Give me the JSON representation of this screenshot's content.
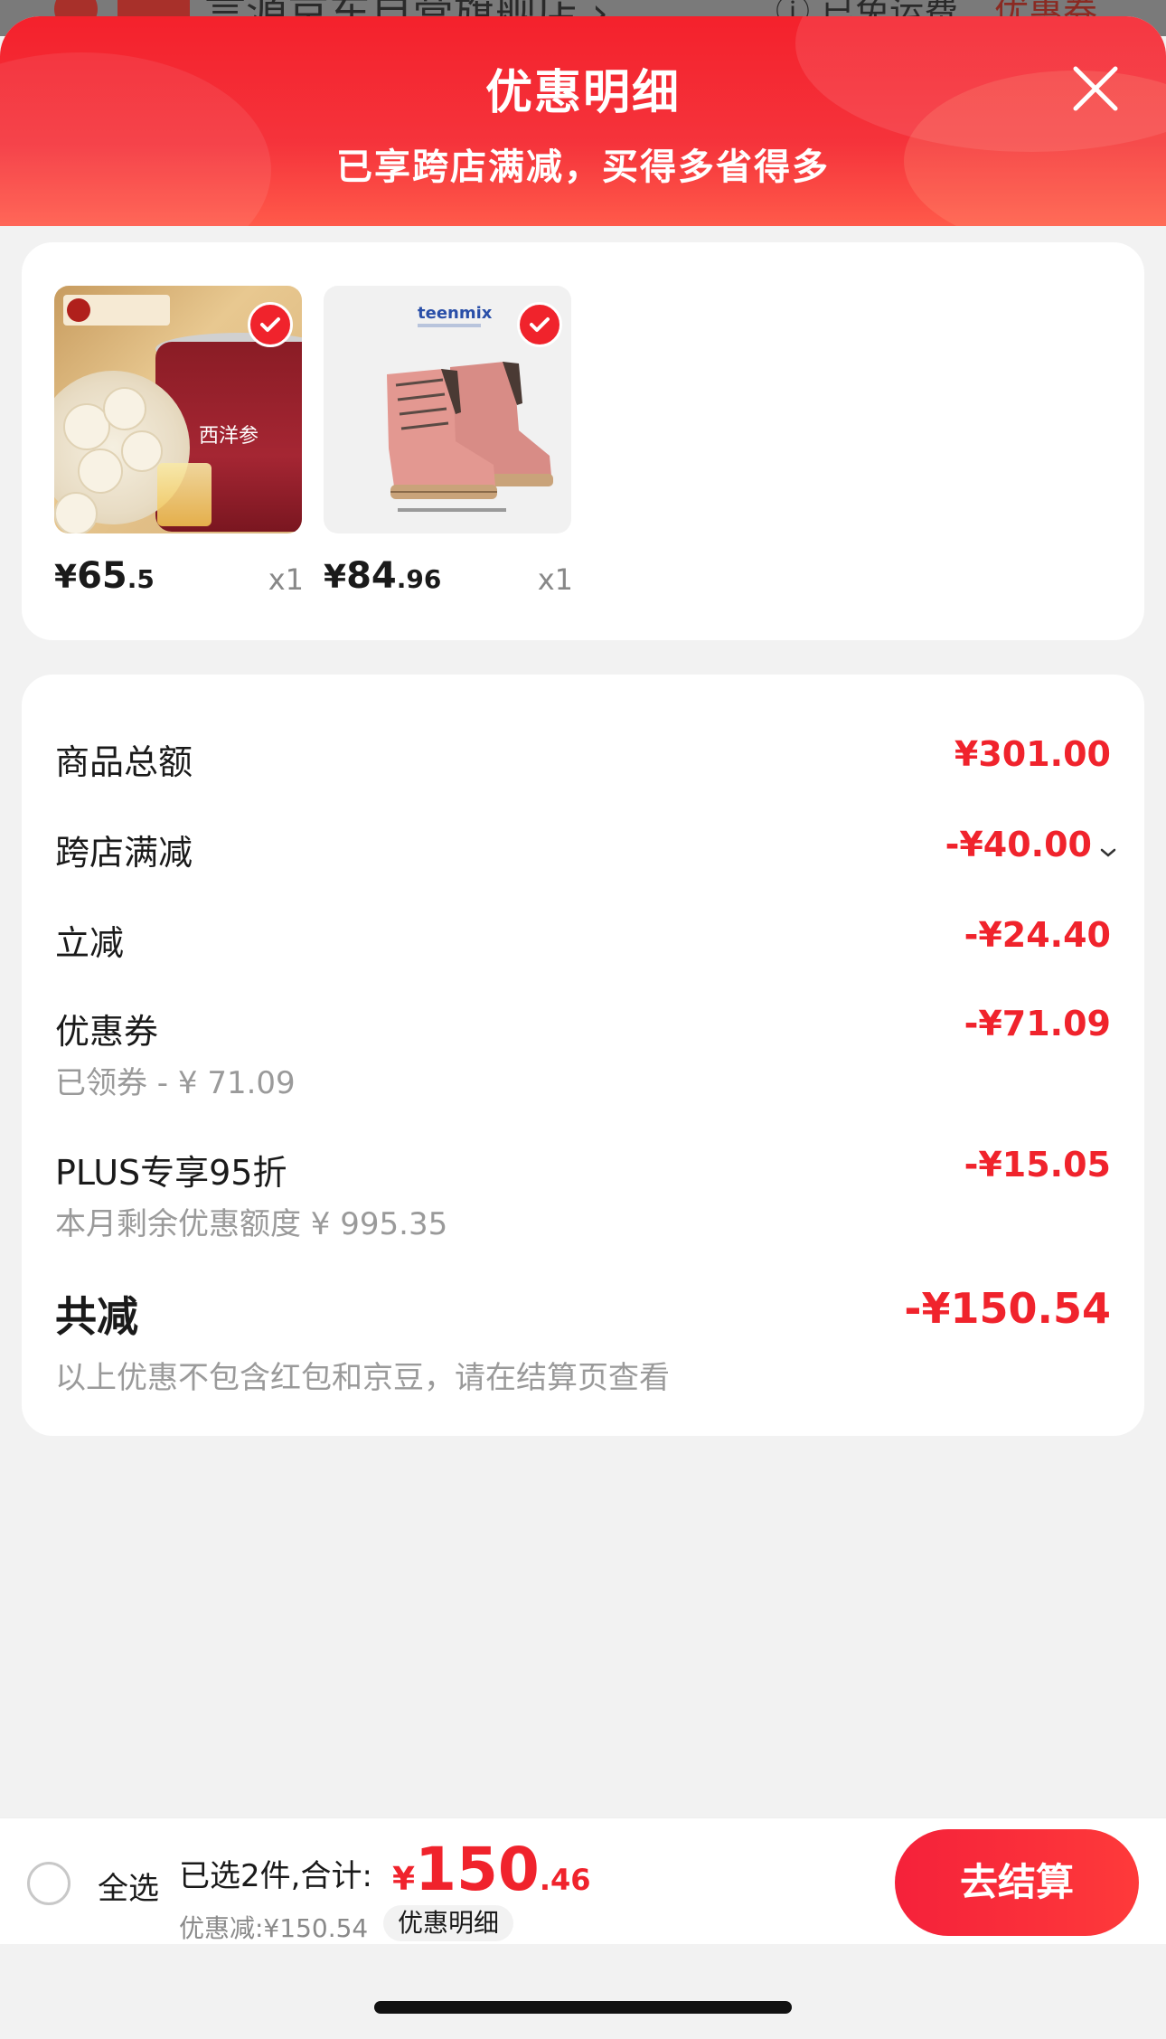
{
  "background_page": {
    "store_name": "言源京东自营旗舰店 ›",
    "free_shipping": "ⓘ 已免运费",
    "coupon": "优惠券"
  },
  "sheet": {
    "title": "优惠明细",
    "subtitle": "已享跨店满减，买得多省得多",
    "close_icon": "close-icon"
  },
  "products": [
    {
      "brand_text": "同仁堂健康",
      "label_text": "西洋参",
      "price_symbol": "¥",
      "price_int": "65",
      "price_dec": ".5",
      "quantity": "x1",
      "selected": true
    },
    {
      "brand_text": "teenmix",
      "price_symbol": "¥",
      "price_int": "84",
      "price_dec": ".96",
      "quantity": "x1",
      "selected": true
    }
  ],
  "details": {
    "rows": [
      {
        "label": "商品总额",
        "value": "¥301.00"
      },
      {
        "label": "跨店满减",
        "value": "-¥40.00"
      },
      {
        "label": "立减",
        "value": "-¥24.40"
      },
      {
        "label": "优惠券",
        "value": "-¥71.09",
        "sub": "已领券 - ¥ 71.09"
      },
      {
        "label": "PLUS专享95折",
        "value": "-¥15.05",
        "sub": "本月剩余优惠额度 ¥ 995.35"
      }
    ],
    "total_label": "共减",
    "total_value": "-¥150.54",
    "note": "以上优惠不包含红包和京豆，请在结算页查看"
  },
  "bottom_bar": {
    "select_all": "全选",
    "summary": "已选2件,合计:",
    "total_symbol": "¥",
    "total_int": "150",
    "total_dec": ".46",
    "discount": "优惠减:¥150.54",
    "detail_button": "优惠明细",
    "checkout_button": "去结算"
  },
  "colors": {
    "accent": "#f0232c",
    "header_gradient_start": "#f4212c",
    "header_gradient_end": "#ff5a4a",
    "muted_text": "#9a9a9a"
  }
}
